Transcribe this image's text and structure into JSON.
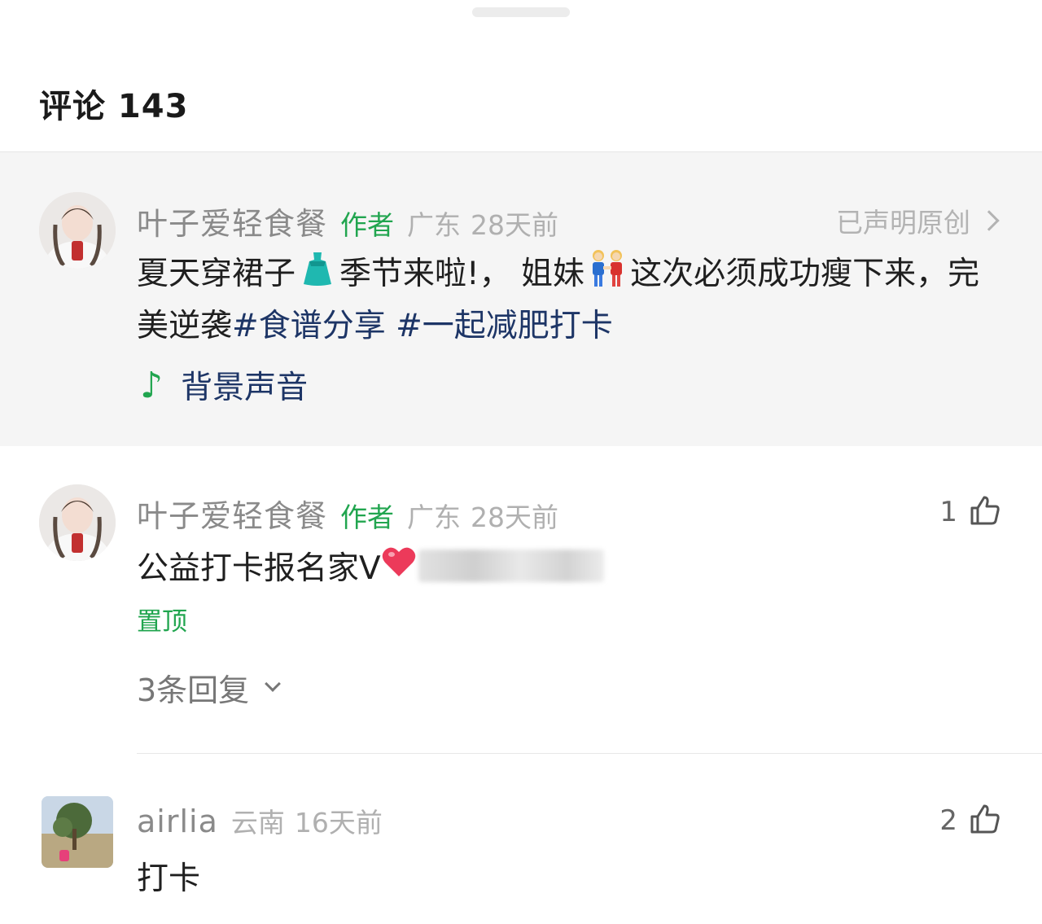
{
  "header": {
    "title": "评论 143"
  },
  "post": {
    "username": "叶子爱轻食餐",
    "author_badge": "作者",
    "location": "广东",
    "time": "28天前",
    "original_label": "已声明原创",
    "text_1": "夏天穿裙子",
    "text_2": "季节来啦!， 姐妹",
    "text_3": "这次必须成功瘦下来，完美逆袭",
    "hashtag_1": "#食谱分享",
    "hashtag_2": "#一起减肥打卡",
    "music_label": "背景声音"
  },
  "comments": [
    {
      "username": "叶子爱轻食餐",
      "author_badge": "作者",
      "location": "广东",
      "time": "28天前",
      "text": "公益打卡报名家V",
      "likes": "1",
      "pinned": "置顶",
      "replies": "3条回复"
    },
    {
      "username": "airlia",
      "location": "云南",
      "time": "16天前",
      "text": "打卡",
      "likes": "2"
    }
  ],
  "colors": {
    "accent_green": "#21a54f",
    "hashtag_blue": "#1d3566",
    "post_bg": "#f5f5f5"
  },
  "icons": [
    "dress-emoji-icon",
    "two-girls-emoji-icon",
    "music-note-icon",
    "chevron-right-icon",
    "heart-emoji-icon",
    "thumbs-up-icon",
    "chevron-down-icon"
  ]
}
